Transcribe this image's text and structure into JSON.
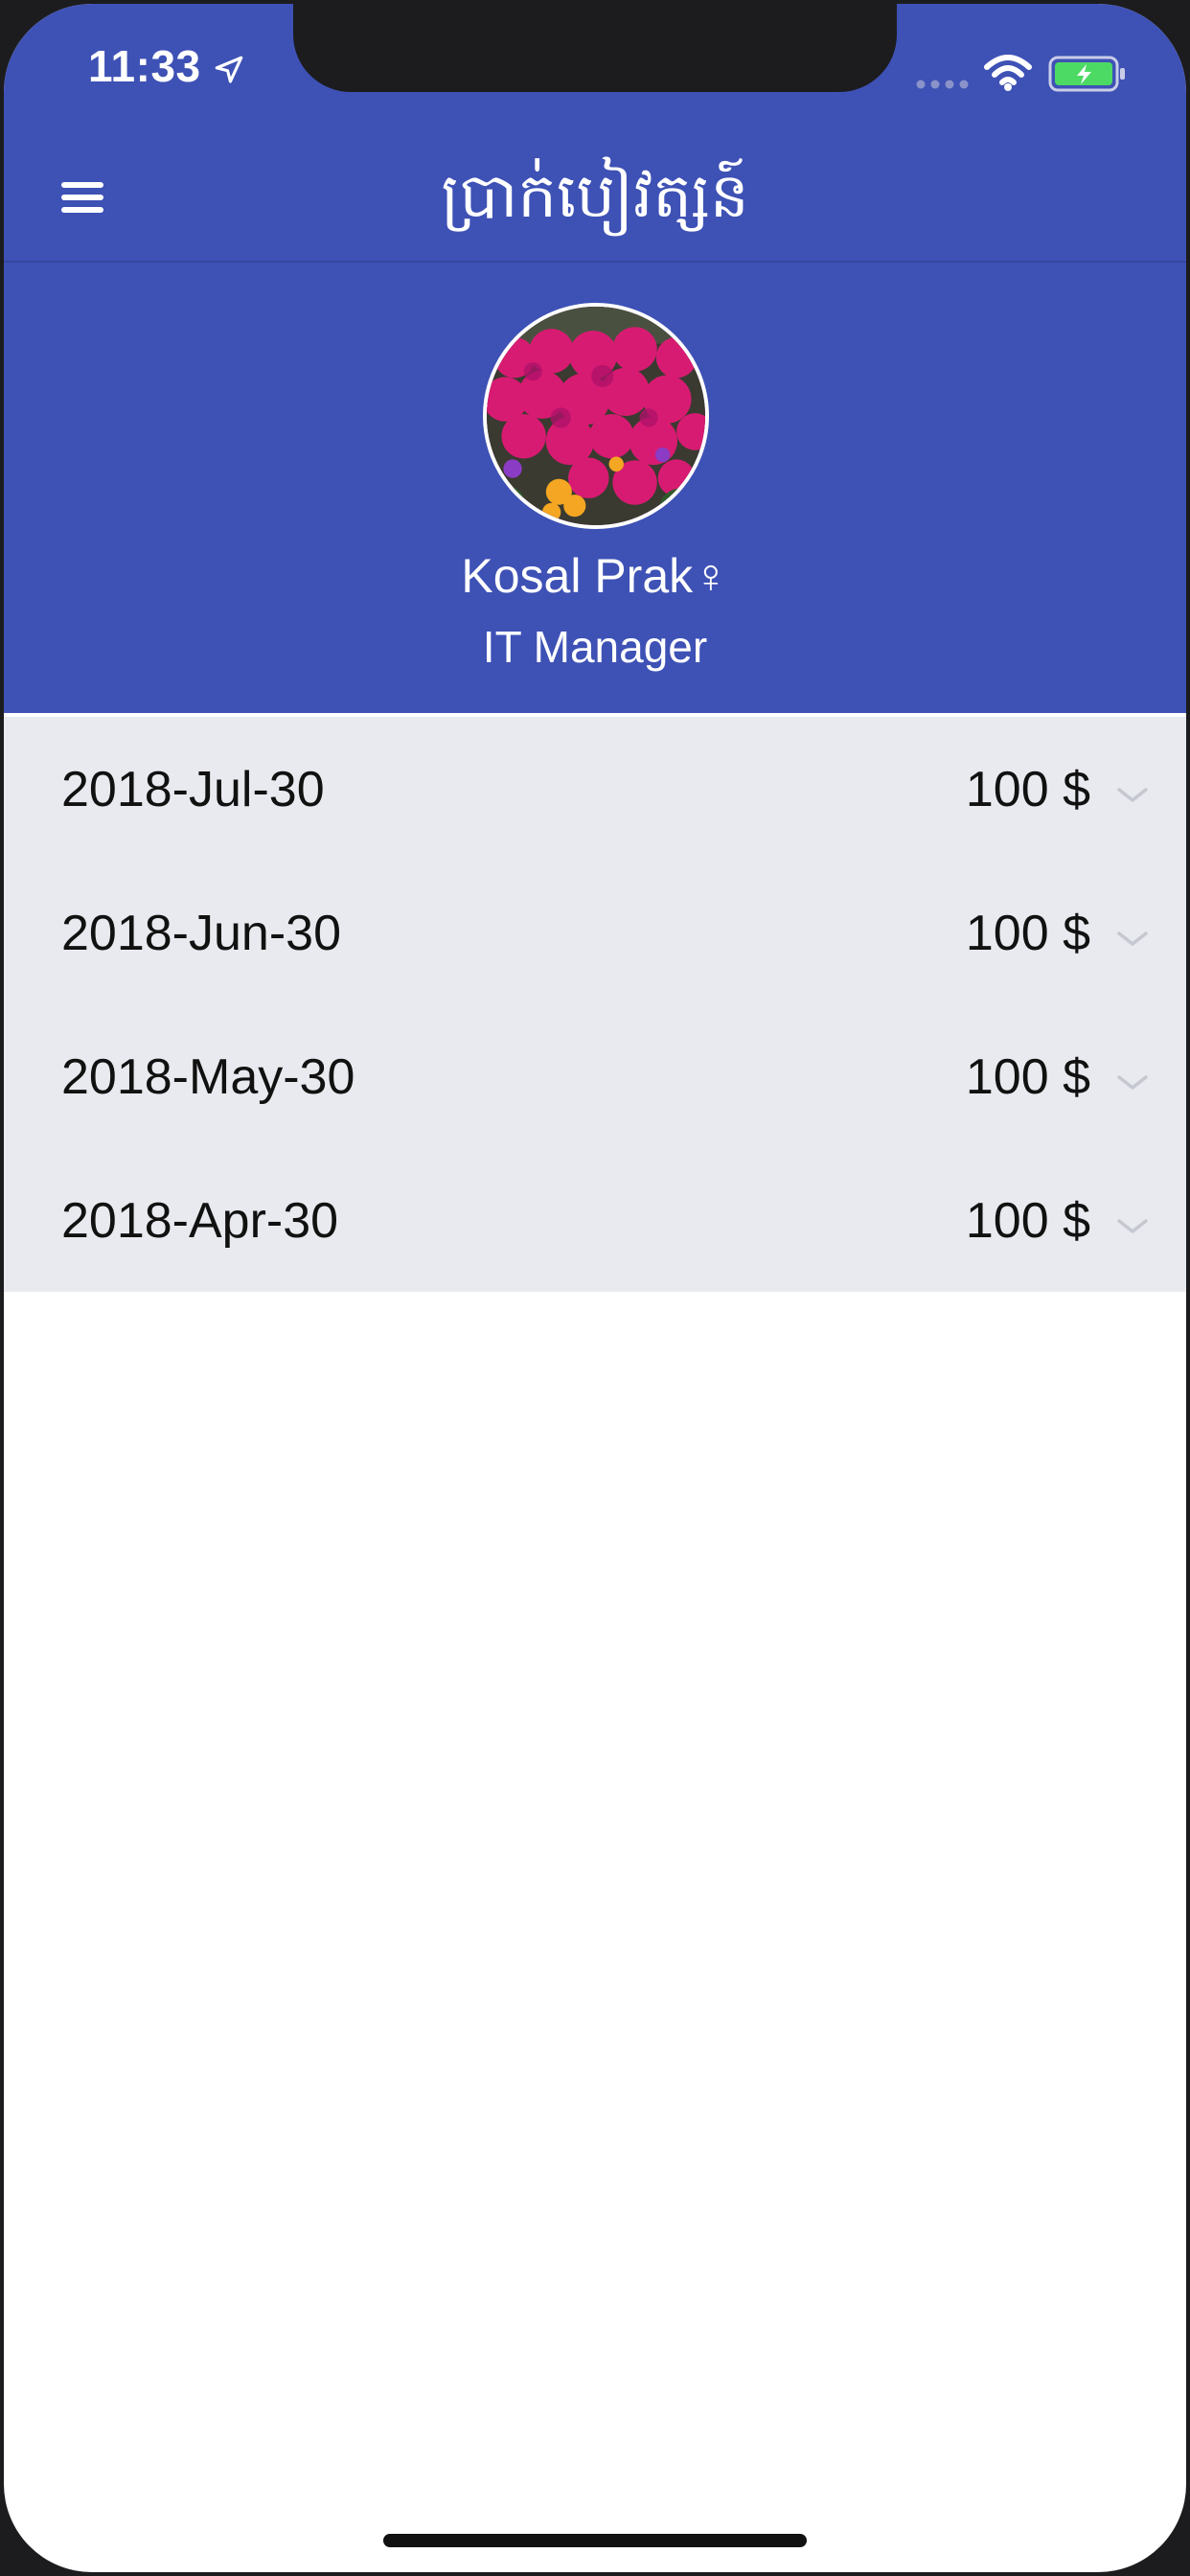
{
  "status_bar": {
    "time": "11:33",
    "location_icon": "location-arrow-icon",
    "signal_icon": "cellular-signal-icon",
    "wifi_icon": "wifi-icon",
    "battery_icon": "battery-charging-icon"
  },
  "nav": {
    "menu_icon": "hamburger-menu-icon",
    "title": "ប្រាក់បៀវត្សន៍"
  },
  "profile": {
    "avatar_icon": "flower-photo-avatar",
    "name": "Kosal Prak♀",
    "role": "IT Manager"
  },
  "salary_list": [
    {
      "date": "2018-Jul-30",
      "amount": "100 $"
    },
    {
      "date": "2018-Jun-30",
      "amount": "100 $"
    },
    {
      "date": "2018-May-30",
      "amount": "100 $"
    },
    {
      "date": "2018-Apr-30",
      "amount": "100 $"
    }
  ],
  "colors": {
    "header_blue": "#3e51b5",
    "list_background": "#e8eaef",
    "battery_green": "#4cd964"
  }
}
